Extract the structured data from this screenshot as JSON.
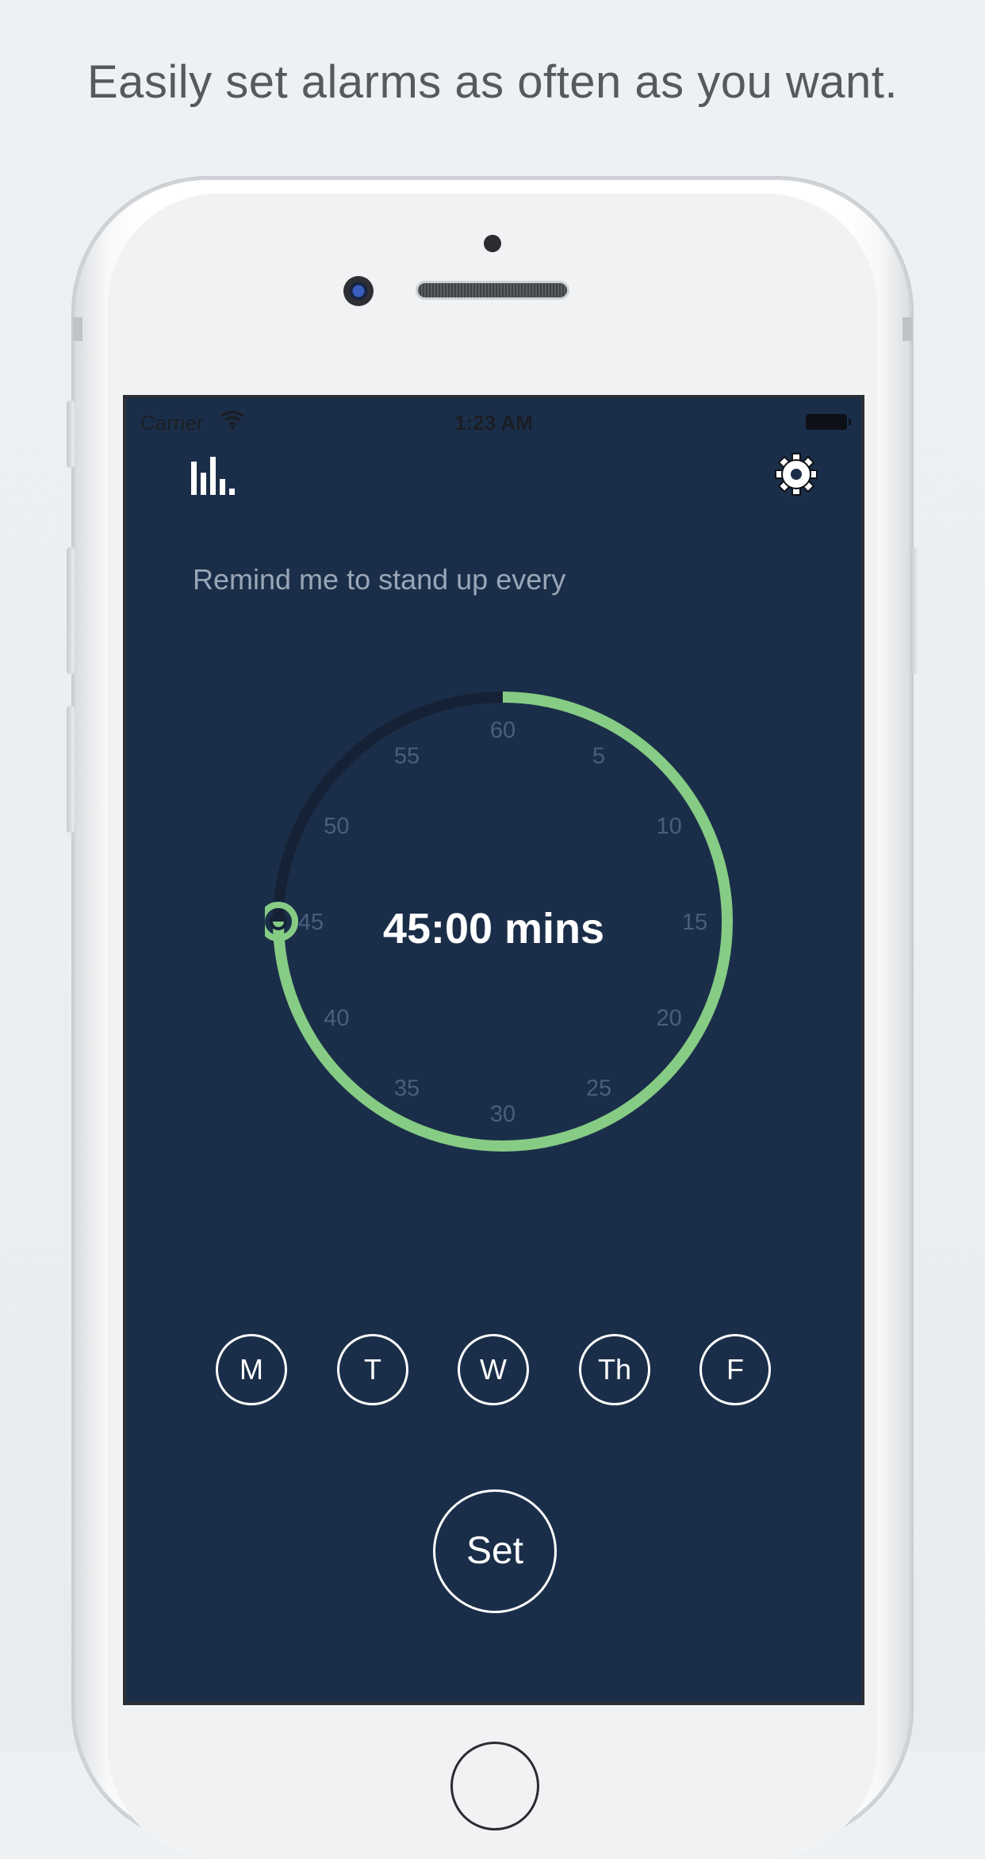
{
  "headline": "Easily set alarms as often as you want.",
  "status_bar": {
    "carrier": "Carrier",
    "time": "1:23 AM"
  },
  "icons": {
    "stats": "bar-chart-icon",
    "settings": "gear-icon",
    "wifi": "wifi-icon",
    "battery": "battery-icon"
  },
  "prompt": "Remind me to stand up every",
  "dial": {
    "ticks": [
      "60",
      "5",
      "10",
      "15",
      "20",
      "25",
      "30",
      "35",
      "40",
      "45",
      "50",
      "55"
    ],
    "selected_minutes": 45,
    "readout": "45:00 mins"
  },
  "days": [
    "M",
    "T",
    "W",
    "Th",
    "F"
  ],
  "set_label": "Set",
  "colors": {
    "background": "#1b2e49",
    "accent": "#86cc85",
    "track": "#152236",
    "tick": "#4a5f7c"
  }
}
